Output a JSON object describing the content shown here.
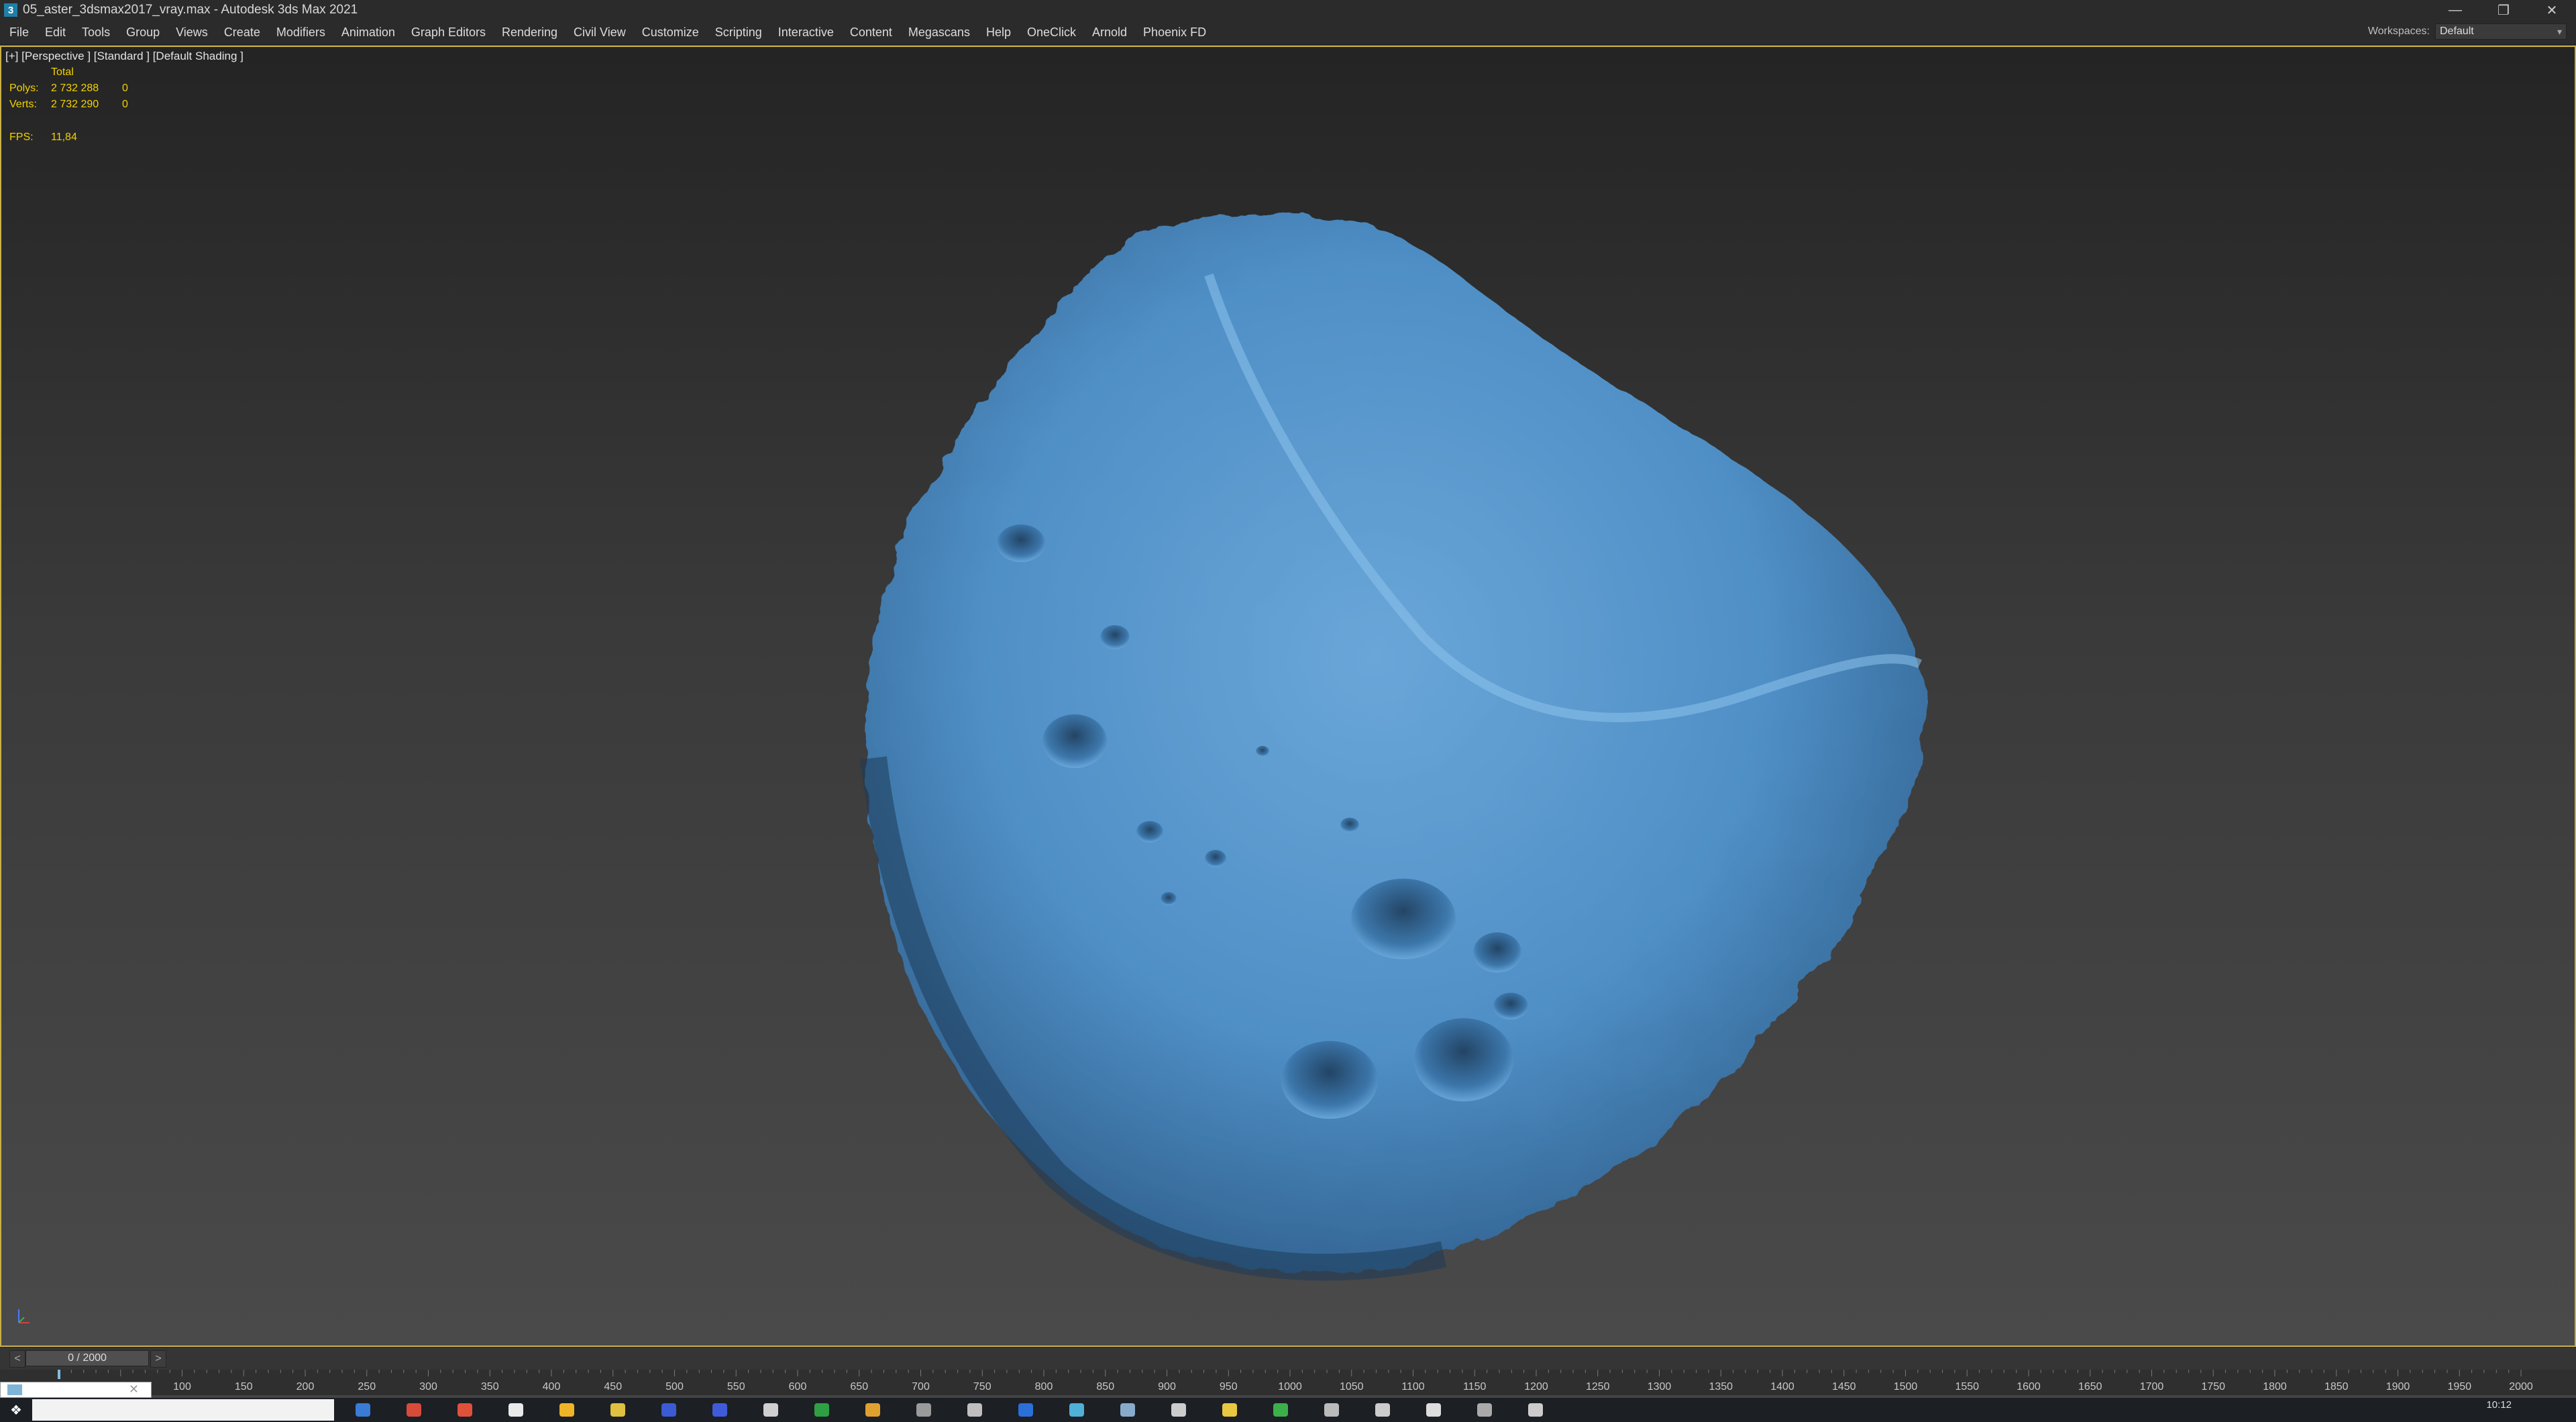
{
  "window": {
    "title": "05_aster_3dsmax2017_vray.max - Autodesk 3ds Max 2021",
    "app_icon_glyph": "3",
    "controls": [
      "minimize-icon",
      "restore-icon",
      "close-icon"
    ]
  },
  "menu": {
    "items": [
      "File",
      "Edit",
      "Tools",
      "Group",
      "Views",
      "Create",
      "Modifiers",
      "Animation",
      "Graph Editors",
      "Rendering",
      "Civil View",
      "Customize",
      "Scripting",
      "Interactive",
      "Content",
      "Megascans",
      "Help",
      "OneClick",
      "Arnold",
      "Phoenix FD"
    ]
  },
  "workspace": {
    "label": "Workspaces:",
    "value": "Default"
  },
  "viewport": {
    "label": "[+] [Perspective ] [Standard ] [Default Shading ]",
    "border_color": "#c8b04a",
    "object_color": "#4f8fc6",
    "stats": {
      "header": "Total",
      "polys_label": "Polys:",
      "polys_value": "2 732 288",
      "polys_sel": "0",
      "verts_label": "Verts:",
      "verts_value": "2 732 290",
      "verts_sel": "0",
      "fps_label": "FPS:",
      "fps_value": "11,84"
    }
  },
  "timeline": {
    "frame_display": "0 / 2000",
    "prev_label": "<",
    "next_label": ">",
    "current_frame": 0,
    "total_frames": 2000,
    "ticks": [
      "100",
      "150",
      "200",
      "250",
      "300",
      "350",
      "400",
      "450",
      "500",
      "550",
      "600",
      "650",
      "700",
      "750",
      "800",
      "850",
      "900",
      "950",
      "1000",
      "1050",
      "1100",
      "1150",
      "1200",
      "1250",
      "1300",
      "1350",
      "1400",
      "1450",
      "1500",
      "1550",
      "1600",
      "1650",
      "1700",
      "1750",
      "1800",
      "1850",
      "1900",
      "1950",
      "2000"
    ]
  },
  "taskbar": {
    "clock": "10:12",
    "icon_colors": [
      "#3a7bd5",
      "#d84b3b",
      "#e0513c",
      "#e9e9e9",
      "#f0b429",
      "#e0c040",
      "#3b5bd5",
      "#3f5bd9",
      "#cfcfcf",
      "#2ea043",
      "#e0a030",
      "#9a9a9a",
      "#bfbfbf",
      "#2b6fd8",
      "#4fb0d8",
      "#88aacc",
      "#cccccc",
      "#e8c840",
      "#3cb04a",
      "#bbbbbb",
      "#cccccc",
      "#ddd",
      "#aaa",
      "#ccc"
    ]
  }
}
